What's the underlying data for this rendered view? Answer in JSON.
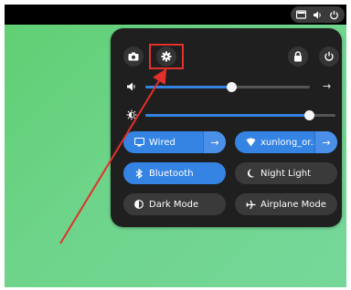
{
  "panel": {
    "network_tiles": [
      {
        "label": "Wired",
        "arrow": "→"
      },
      {
        "label": "xunlong_or...",
        "arrow": "→"
      }
    ],
    "toggle_tiles": [
      {
        "label": "Bluetooth",
        "active": true
      },
      {
        "label": "Night Light",
        "active": false
      },
      {
        "label": "Dark Mode",
        "active": false
      },
      {
        "label": "Airplane Mode",
        "active": false
      }
    ],
    "volume": {
      "level": 0.52,
      "arrow": "→"
    },
    "brightness": {
      "level": 0.86
    }
  },
  "colors": {
    "accent": "#3584e4",
    "panel_bg": "#1f1f1f",
    "annotation_red": "#e3302a",
    "desktop_green": "#6ed48a"
  }
}
